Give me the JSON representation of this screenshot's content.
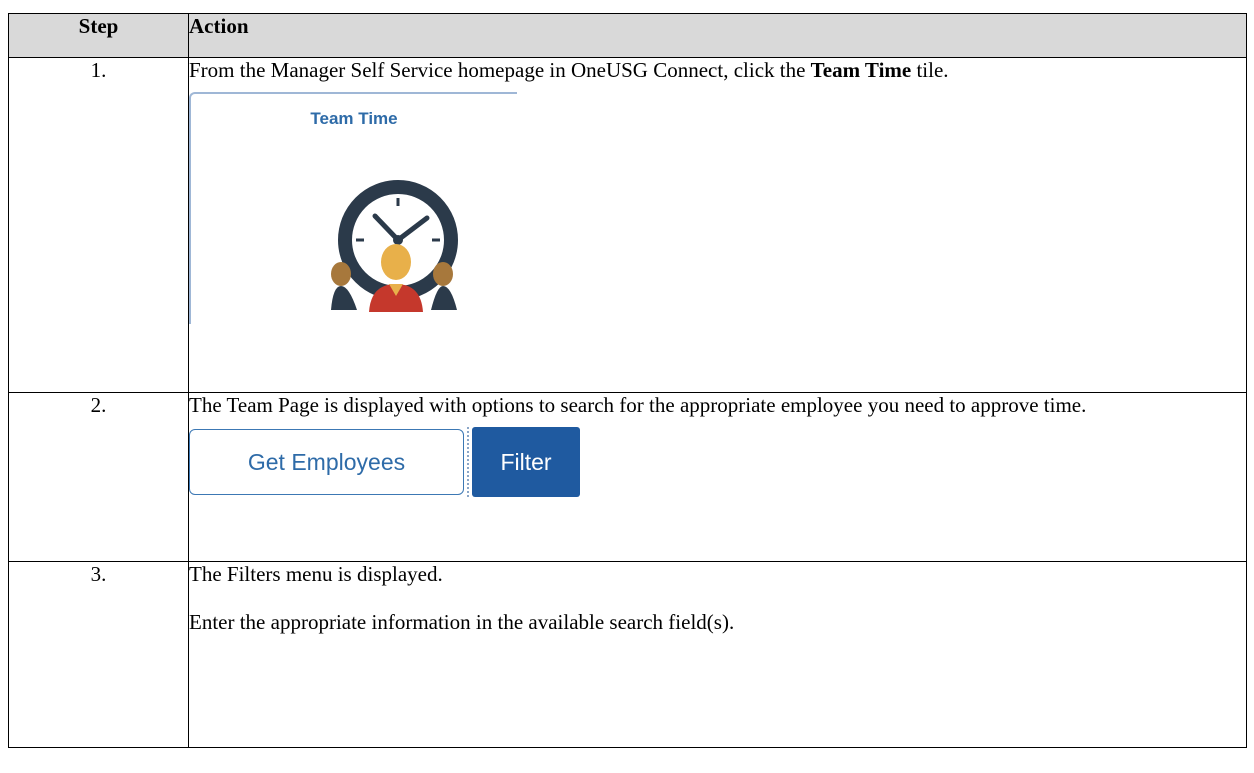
{
  "table": {
    "header": {
      "step": "Step",
      "action": "Action"
    },
    "rows": [
      {
        "step": "1.",
        "text_before": "From the Manager Self Service homepage in OneUSG Connect, click the ",
        "text_bold": "Team Time",
        "text_after": " tile.",
        "tile_title": "Team Time"
      },
      {
        "step": "2.",
        "text": "The Team Page is displayed with options to search for the appropriate employee you need to approve time.",
        "button_get": "Get Employees",
        "button_filter": "Filter"
      },
      {
        "step": "3.",
        "text1": "The Filters menu is displayed.",
        "text2": "Enter the appropriate information in the available search field(s)."
      }
    ]
  },
  "colors": {
    "tile_title": "#2e6ba8",
    "filter_button": "#1f5aa0",
    "header_bg": "#d9d9d9"
  },
  "icons": {
    "tile_icon": "team-time-clock-icon"
  }
}
